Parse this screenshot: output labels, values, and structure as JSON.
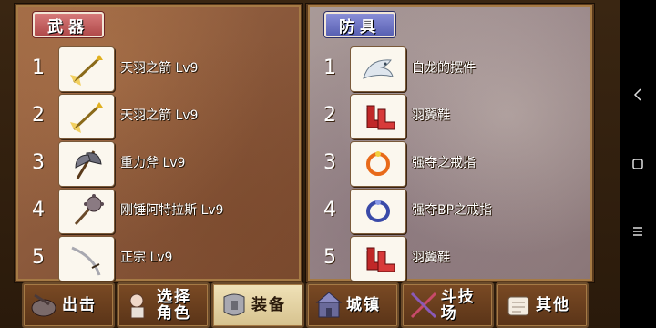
{
  "weapons": {
    "title": "武器",
    "items": [
      {
        "num": "1",
        "name": "天羽之箭 Lv9",
        "icon": "arrow-icon"
      },
      {
        "num": "2",
        "name": "天羽之箭 Lv9",
        "icon": "arrow-icon"
      },
      {
        "num": "3",
        "name": "重力斧 Lv9",
        "icon": "axe-icon"
      },
      {
        "num": "4",
        "name": "刚锤阿特拉斯 Lv9",
        "icon": "mace-icon"
      },
      {
        "num": "5",
        "name": "正宗 Lv9",
        "icon": "katana-icon"
      }
    ]
  },
  "armor": {
    "title": "防具",
    "items": [
      {
        "num": "1",
        "name": "白龙的摆件",
        "icon": "white-dragon-ornament-icon"
      },
      {
        "num": "2",
        "name": "羽翼鞋",
        "icon": "winged-boots-icon"
      },
      {
        "num": "3",
        "name": "强夺之戒指",
        "icon": "ring-icon"
      },
      {
        "num": "4",
        "name": "强夺BP之戒指",
        "icon": "bp-ring-icon"
      },
      {
        "num": "5",
        "name": "羽翼鞋",
        "icon": "winged-boots-icon"
      }
    ]
  },
  "nav": {
    "tabs": [
      {
        "label": "出击",
        "icon": "sortie-icon",
        "active": false
      },
      {
        "label": "选择角色",
        "line1": "选择",
        "line2": "角色",
        "icon": "character-icon",
        "active": false
      },
      {
        "label": "装备",
        "icon": "armor-icon",
        "active": true
      },
      {
        "label": "城镇",
        "icon": "town-icon",
        "active": false
      },
      {
        "label": "斗技场",
        "icon": "arena-icon",
        "active": false
      },
      {
        "label": "其他",
        "icon": "scroll-icon",
        "active": false
      }
    ]
  },
  "system_nav": {
    "back": "back-icon",
    "home": "home-icon",
    "menu": "menu-icon"
  },
  "colors": {
    "weapons_tag": "#b04a4a",
    "armor_tag": "#5860b2",
    "active_tab": "#f0e2b8"
  }
}
